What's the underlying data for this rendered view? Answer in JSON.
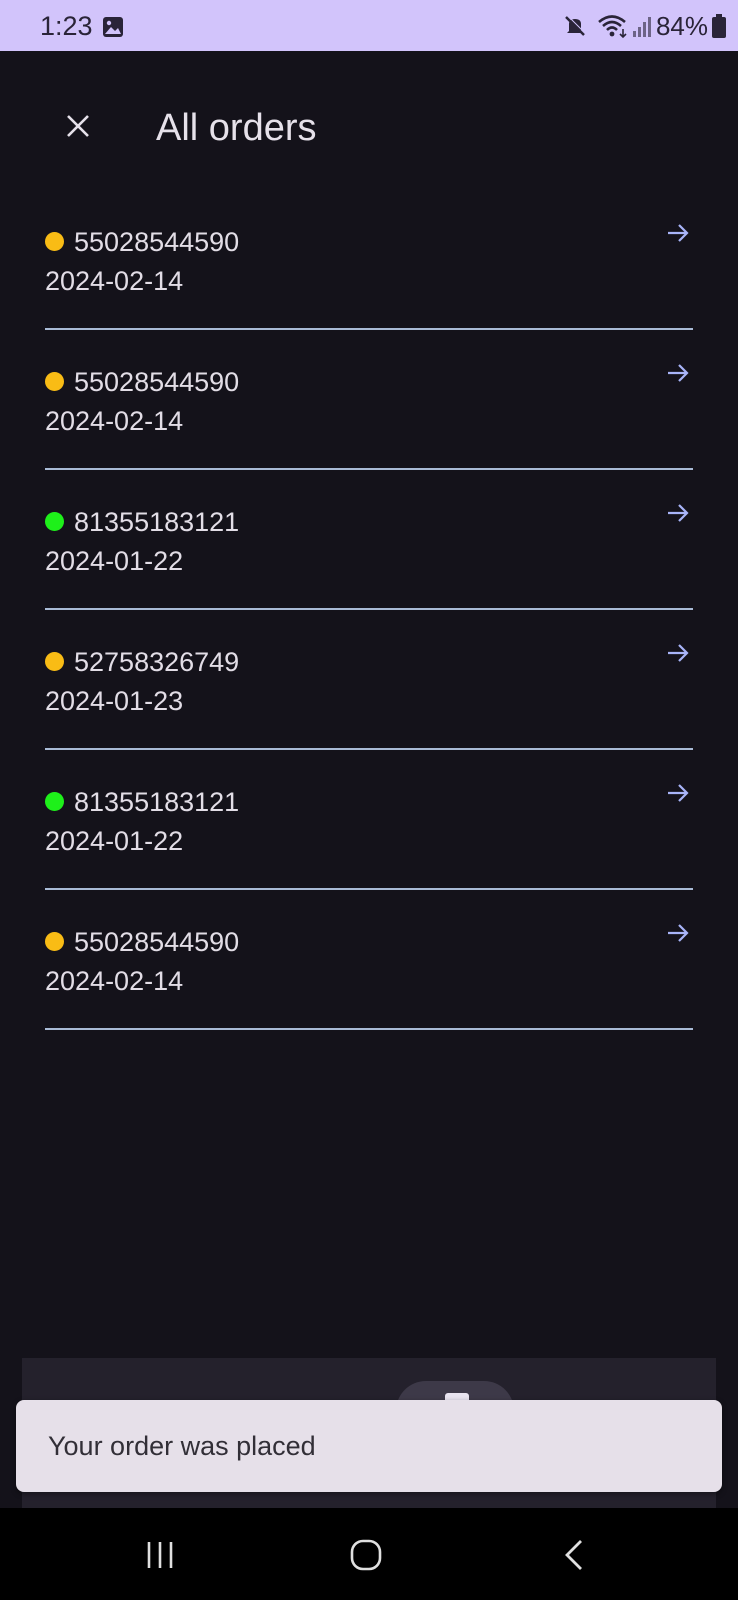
{
  "status_bar": {
    "time": "1:23",
    "battery": "84%",
    "icons": [
      "image-icon",
      "mute-icon",
      "wifi-icon",
      "signal-icon",
      "battery-icon"
    ]
  },
  "header": {
    "title": "All orders",
    "close_icon": "close-icon"
  },
  "orders": [
    {
      "number": "55028544590",
      "date": "2024-02-14",
      "status_color": "#f9bc15"
    },
    {
      "number": "55028544590",
      "date": "2024-02-14",
      "status_color": "#f9bc15"
    },
    {
      "number": "81355183121",
      "date": "2024-01-22",
      "status_color": "#1ef01a"
    },
    {
      "number": "52758326749",
      "date": "2024-01-23",
      "status_color": "#f9bc15"
    },
    {
      "number": "81355183121",
      "date": "2024-01-22",
      "status_color": "#1ef01a"
    },
    {
      "number": "55028544590",
      "date": "2024-02-14",
      "status_color": "#f9bc15"
    }
  ],
  "snackbar": {
    "message": "Your order was placed"
  },
  "colors": {
    "background": "#14121a",
    "status_bar": "#d2c4fb",
    "accent_arrow": "#a8b4f8",
    "divider": "#a9bbd6",
    "pending": "#f9bc15",
    "complete": "#1ef01a"
  },
  "nav": {
    "icons": [
      "recents-icon",
      "home-icon",
      "back-icon"
    ]
  }
}
